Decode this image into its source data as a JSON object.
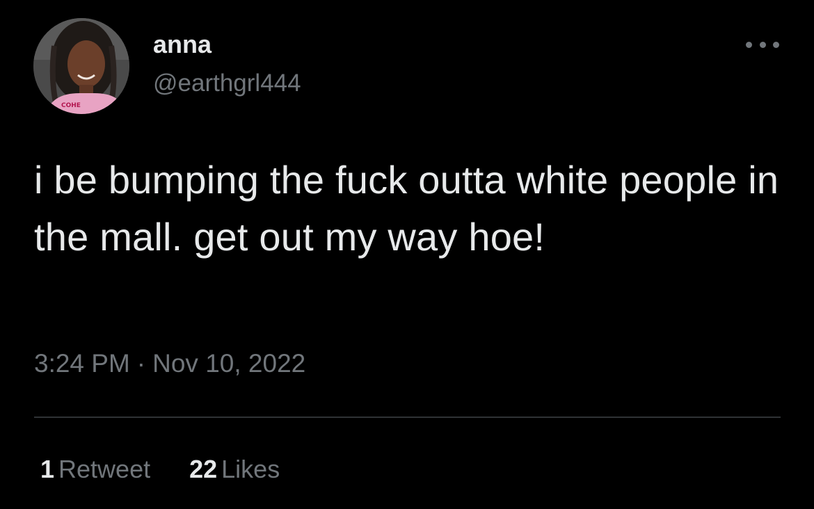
{
  "author": {
    "display_name": "anna",
    "handle": "@earthgrl444",
    "avatar_shirt_text": "COHE"
  },
  "tweet": {
    "text": "i be bumping the fuck outta white people in the mall. get out my way hoe!",
    "time": "3:24 PM",
    "separator": "·",
    "date": "Nov 10, 2022"
  },
  "stats": {
    "retweets_count": "1",
    "retweets_label": "Retweet",
    "likes_count": "22",
    "likes_label": "Likes"
  },
  "icons": {
    "more": "more-horizontal-icon"
  },
  "colors": {
    "background": "#000000",
    "primary_text": "#e7e9ea",
    "secondary_text": "#71767b",
    "divider": "#2f3336"
  }
}
